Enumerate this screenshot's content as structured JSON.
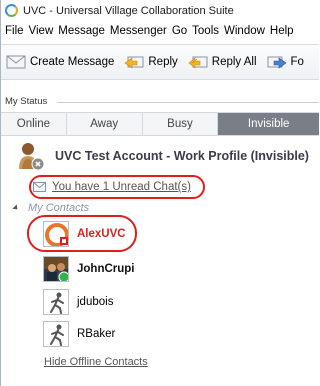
{
  "window": {
    "title": "UVC - Universal Village Collaboration Suite"
  },
  "menu": [
    "File",
    "View",
    "Message",
    "Messenger",
    "Go",
    "Tools",
    "Window",
    "Help"
  ],
  "toolbar": {
    "create_message": "Create Message",
    "reply": "Reply",
    "reply_all": "Reply All",
    "forward": "Fo"
  },
  "status": {
    "label": "My Status",
    "tabs": [
      {
        "label": "Online",
        "active": false
      },
      {
        "label": "Away",
        "active": false
      },
      {
        "label": "Busy",
        "active": false
      },
      {
        "label": "Invisible",
        "active": true
      }
    ]
  },
  "account": {
    "name": "UVC Test Account - Work Profile (Invisible)"
  },
  "unread": {
    "text": "You have 1 Unread Chat(s)"
  },
  "contacts": {
    "header": "My Contacts",
    "items": [
      {
        "name": "AlexUVC",
        "style": "red",
        "icon": "uvc-logo-avatar"
      },
      {
        "name": "JohnCrupi",
        "style": "bold",
        "icon": "photo-avatar"
      },
      {
        "name": "jdubois",
        "style": "normal",
        "icon": "walking-man-avatar"
      },
      {
        "name": "RBaker",
        "style": "normal",
        "icon": "walking-man-avatar"
      }
    ],
    "hide_offline": "Hide Offline Contacts"
  },
  "colors": {
    "highlight": "#e01e1e",
    "active_tab": "#7a7f87",
    "contacts_header": "#8a94a6"
  }
}
